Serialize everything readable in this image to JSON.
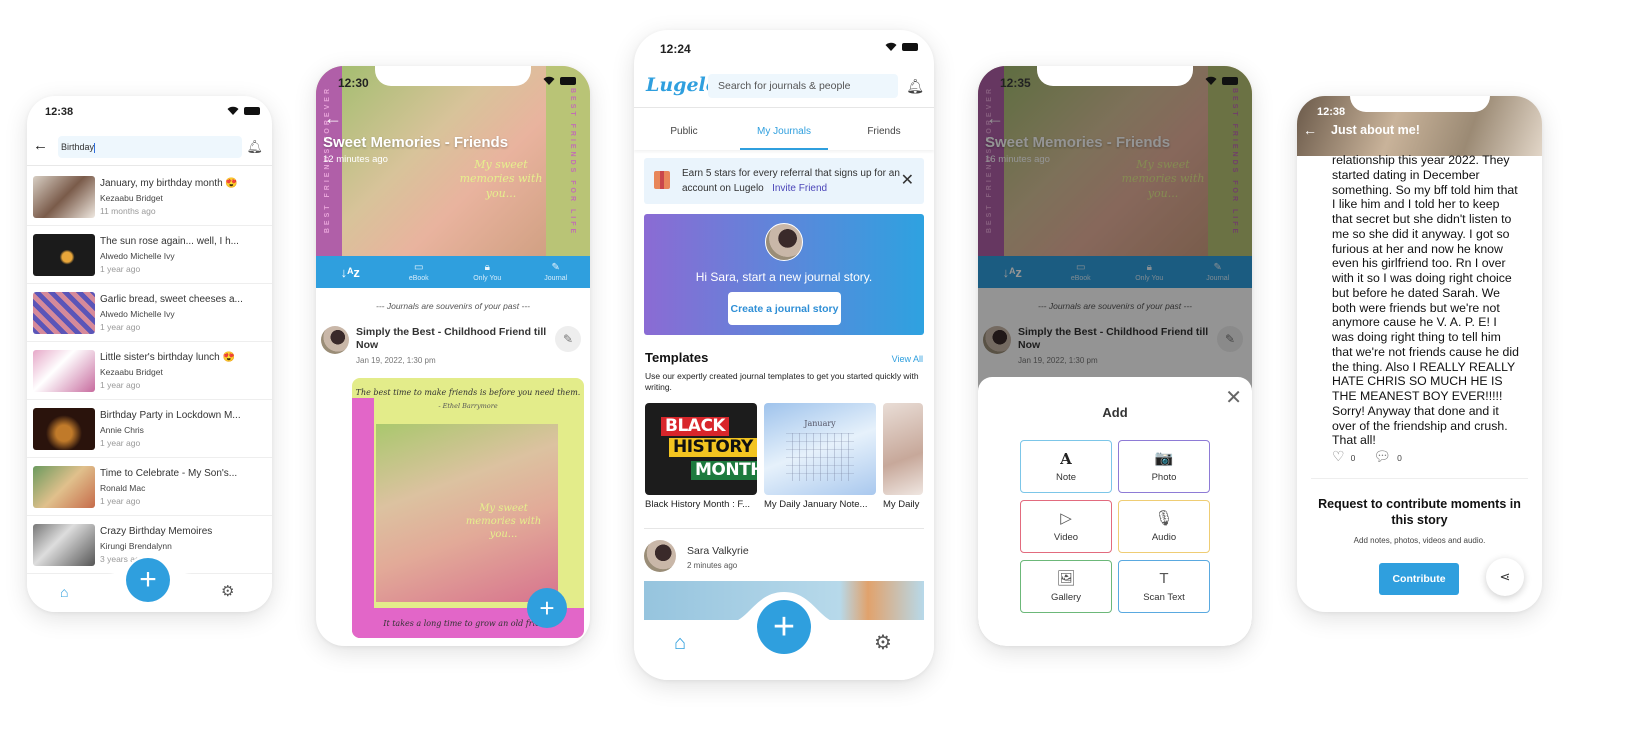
{
  "app_name": "Lugelo",
  "colors": {
    "accent": "#2f9fde",
    "promo_from": "#8b6bd4",
    "promo_to": "#2ea2e0"
  },
  "search_screen": {
    "time": "12:38",
    "query": "Birthday",
    "icons": {
      "back": "back-arrow-icon",
      "bell": "bell-icon"
    },
    "results": [
      {
        "title": "January, my birthday month 😍",
        "author": "Kezaabu Bridget",
        "date": "11 months ago"
      },
      {
        "title": "The sun rose again... well, I h...",
        "author": "Alwedo Michelle Ivy",
        "date": "1 year ago"
      },
      {
        "title": "Garlic bread, sweet cheeses a...",
        "author": "Alwedo Michelle Ivy",
        "date": "1 year ago"
      },
      {
        "title": "Little sister's birthday lunch 😍",
        "author": "Kezaabu Bridget",
        "date": "1 year ago"
      },
      {
        "title": "Birthday Party in Lockdown M...",
        "author": "Annie Chris",
        "date": "1 year ago"
      },
      {
        "title": "Time to Celebrate - My Son's...",
        "author": "Ronald Mac",
        "date": "1 year ago"
      },
      {
        "title": "Crazy Birthday Memoires",
        "author": "Kirungi Brendalynn",
        "date": "3 years ago"
      }
    ],
    "fab_label": "+"
  },
  "journal_screen": {
    "time": "12:30",
    "title": "Sweet Memories - Friends",
    "subtitle": "12 minutes ago",
    "cover_left_text": "BEST FRIENDS FOREVER",
    "cover_right_text": "BEST FRIENDS FOR LIFE",
    "cover_script": "My sweet memories with you...",
    "toolbar": [
      {
        "icon": "sort-az-icon",
        "label": "↓ᴬz"
      },
      {
        "icon": "book-icon",
        "glyph": "🕮",
        "label": "eBook"
      },
      {
        "icon": "lock-icon",
        "glyph": "🔒",
        "label": "Only You"
      },
      {
        "icon": "pen-icon",
        "glyph": "✎",
        "label": "Journal"
      }
    ],
    "tagline": "--- Journals are souvenirs of your past ---",
    "entry": {
      "title": "Simply the Best - Childhood Friend till Now",
      "date": "Jan 19, 2022, 1:30 pm"
    },
    "card_quote": "The best time to make friends is before you need them.",
    "card_quote_author": "- Ethel Barrymore",
    "card_photo_text": "My sweet memories with you...",
    "card_bottom_quote": "It takes a long time to grow an old friend.",
    "fab_label": "+"
  },
  "home_screen": {
    "time": "12:24",
    "logo": "Lugelo",
    "search_placeholder": "Search for journals & people",
    "tabs": [
      {
        "label": "Public",
        "active": false
      },
      {
        "label": "My Journals",
        "active": true
      },
      {
        "label": "Friends",
        "active": false
      }
    ],
    "banner_text": "Earn 5 stars for every referral that signs up for an account on Lugelo",
    "banner_link": "Invite Friend",
    "promo_message": "Hi Sara, start a new journal story.",
    "promo_button": "Create a journal story",
    "templates_heading": "Templates",
    "templates_view_all": "View All",
    "templates_desc": "Use our expertly created journal templates to get you started quickly with writing.",
    "templates": [
      {
        "caption": "Black History Month : F...",
        "art_lines": [
          "BLACK",
          "HISTORY",
          "MONTH"
        ]
      },
      {
        "caption": "My Daily January Note...",
        "art_month": "January"
      },
      {
        "caption": "My Daily"
      }
    ],
    "poster": {
      "name": "Sara Valkyrie",
      "time": "2 minutes ago"
    },
    "fab_label": "+"
  },
  "add_sheet_screen": {
    "time": "12:35",
    "title": "Sweet Memories - Friends",
    "subtitle": "16 minutes ago",
    "sheet_title": "Add",
    "options": [
      {
        "label": "Note",
        "icon": "text-a-icon",
        "glyph": "A",
        "color": "#7cc6e8"
      },
      {
        "label": "Photo",
        "icon": "camera-icon",
        "glyph": "📷",
        "color": "#8e7bd6"
      },
      {
        "label": "Video",
        "icon": "video-icon",
        "glyph": "▷",
        "color": "#e26b7e"
      },
      {
        "label": "Audio",
        "icon": "microphone-icon",
        "glyph": "🎙",
        "color": "#efcd74"
      },
      {
        "label": "Gallery",
        "icon": "gallery-icon",
        "glyph": "🖼",
        "color": "#6cb879"
      },
      {
        "label": "Scan Text",
        "icon": "scan-text-icon",
        "glyph": "T",
        "color": "#5aa9e0"
      }
    ]
  },
  "story_screen": {
    "time": "12:38",
    "title": "Just about me!",
    "body": "relationship this year 2022. They started dating in December something. So my bff told him that I like him and I told her to keep that secret but she didn't listen to me so she did it anyway. I got so furious at her and now he know even his girlfriend too. Rn I over with it so I was doing right choice but before he dated Sarah. We both were friends but we're not anymore cause he V. A. P. E! I was doing right thing to tell him that we're not friends cause he did the thing. Also I REALLY REALLY HATE CHRIS SO MUCH HE IS THE MEANEST BOY EVER!!!!! Sorry! Anyway that done and it over of the friendship and crush. That all!",
    "likes": "0",
    "comments": "0",
    "request_title": "Request to contribute moments in this story",
    "request_sub": "Add notes, photos, videos and audio.",
    "contribute_label": "Contribute"
  }
}
